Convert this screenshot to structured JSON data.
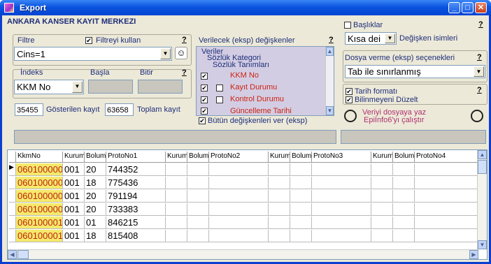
{
  "window": {
    "title": "Export"
  },
  "header": {
    "org": "ANKARA KANSER KAYIT MERKEZI"
  },
  "filter": {
    "label": "Filtre",
    "use_label": "Filtreyi kullan",
    "help": "?",
    "value": "Cins=1"
  },
  "index": {
    "label": "İndeks",
    "start_label": "Başla",
    "end_label": "Bitir",
    "help": "?",
    "value": "KKM No"
  },
  "counts": {
    "shown": "35455",
    "shown_label": "Gösterilen kayıt",
    "total": "63658",
    "total_label": "Toplam kayıt"
  },
  "variables": {
    "label": "Verilecek (eksp) değişkenler",
    "help": "?",
    "items": [
      "Veriler",
      "Sözlük Kategori",
      "Sözlük Tanımları",
      "KKM No",
      "Kayıt Durumu",
      "Kontrol Durumu",
      "Güncelleme Tarihi"
    ],
    "give_all": "Bütün değişkenleri ver (eksp)"
  },
  "headers": {
    "label": "Başlıklar",
    "help": "?",
    "short_value": "Kısa dei",
    "varnames": "Değişken isimleri"
  },
  "export_opts": {
    "label": "Dosya verme (eksp) seçenekleri",
    "help": "?",
    "value": "Tab ile sınırlanmış"
  },
  "options": {
    "date_format": "Tarih formatı",
    "fix_unknown": "Bilinmeyeni Düzelt",
    "help": "?"
  },
  "actions": {
    "write": "Veriyi dosyaya yaz",
    "run_epi": "EpiInfo6'yı çalıştır"
  },
  "grid": {
    "columns": [
      "KkmNo",
      "Kurum",
      "Bolum",
      "ProtoNo1",
      "Kurum",
      "Bolum",
      "ProtoNo2",
      "Kurum",
      "Bolum",
      "ProtoNo3",
      "Kurum",
      "Bolum",
      "ProtoNo4"
    ],
    "rows": [
      [
        "060100000",
        "001",
        "20",
        "744352"
      ],
      [
        "060100000",
        "001",
        "18",
        "775436"
      ],
      [
        "060100000",
        "001",
        "20",
        "791194"
      ],
      [
        "060100000",
        "001",
        "20",
        "733383"
      ],
      [
        "060100001",
        "001",
        "01",
        "846215"
      ],
      [
        "060100001",
        "001",
        "18",
        "815408"
      ]
    ]
  }
}
